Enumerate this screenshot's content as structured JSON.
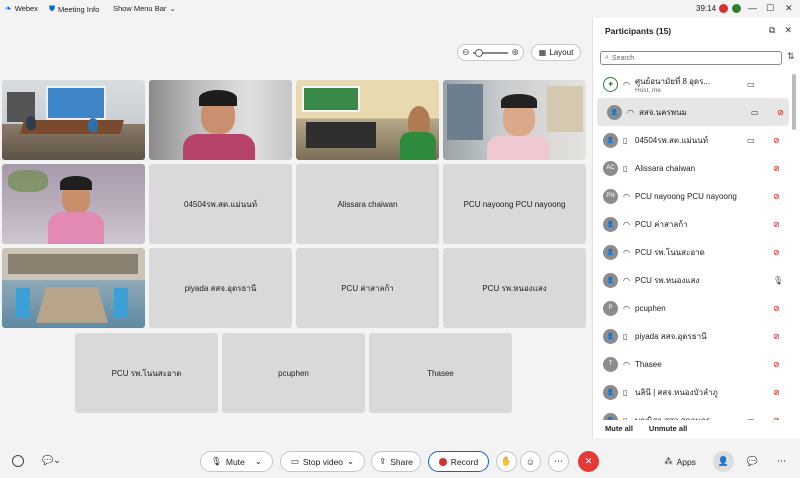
{
  "topbar": {
    "app_name": "Webex",
    "meeting_info": "Meeting Info",
    "show_menu_bar": "Show Menu Bar",
    "time": "39:14"
  },
  "stage": {
    "layout_label": "Layout",
    "tiles": [
      {
        "name": "04504รพ.สต.แม่นนท์"
      },
      {
        "name": "Alissara chaiwan"
      },
      {
        "name": "PCU nayoong PCU nayoong"
      },
      {
        "name": "piyada สสจ.อุดรธานี"
      },
      {
        "name": "PCU ค่าสาลก้า"
      },
      {
        "name": "PCU รพ.หนองแสง"
      },
      {
        "name": "PCU รพ.โนนสะอาด"
      },
      {
        "name": "pcuphen"
      },
      {
        "name": "Thasee"
      }
    ]
  },
  "bottombar": {
    "mute": "Mute",
    "stop_video": "Stop video",
    "share": "Share",
    "record": "Record",
    "apps": "Apps"
  },
  "panel": {
    "title": "Participants (15)",
    "search_placeholder": "Search",
    "mute_all": "Mute all",
    "unmute_all": "Unmute all",
    "participants": [
      {
        "name": "ศูนย์อนามัยที่ 8 อุดร...",
        "sub": "Host, me",
        "avatar": "",
        "device": "headset",
        "camera": true,
        "muted": false
      },
      {
        "name": "สสจ.นครพนม",
        "sub": "",
        "avatar": "",
        "device": "headset",
        "camera": true,
        "muted": true
      },
      {
        "name": "04504รพ.สต.แม่นนท์",
        "sub": "",
        "avatar": "",
        "device": "phone",
        "camera": true,
        "muted": true
      },
      {
        "name": "Alissara chaiwan",
        "sub": "",
        "avatar": "AC",
        "device": "phone",
        "camera": false,
        "muted": true
      },
      {
        "name": "PCU nayoong PCU nayoong",
        "sub": "",
        "avatar": "PN",
        "device": "headset",
        "camera": false,
        "muted": true
      },
      {
        "name": "PCU ค่าสาลก้า",
        "sub": "",
        "avatar": "",
        "device": "headset",
        "camera": false,
        "muted": true
      },
      {
        "name": "PCU รพ.โนนสะอาด",
        "sub": "",
        "avatar": "",
        "device": "headset",
        "camera": false,
        "muted": true
      },
      {
        "name": "PCU รพ.หนองแสง",
        "sub": "",
        "avatar": "",
        "device": "headset",
        "camera": false,
        "muted": false
      },
      {
        "name": "pcuphen",
        "sub": "",
        "avatar": "P",
        "device": "headset",
        "camera": false,
        "muted": true
      },
      {
        "name": "piyada สสจ.อุดรธานี",
        "sub": "",
        "avatar": "",
        "device": "phone",
        "camera": false,
        "muted": true
      },
      {
        "name": "Thasee",
        "sub": "",
        "avatar": "T",
        "device": "headset",
        "camera": false,
        "muted": true
      },
      {
        "name": "นลินี | สสจ.หนองบัวลำภู",
        "sub": "",
        "avatar": "",
        "device": "phone",
        "camera": false,
        "muted": true
      },
      {
        "name": "บุญนิสา สสจ.สกลนคร",
        "sub": "",
        "avatar": "",
        "device": "phone",
        "camera": true,
        "muted": true
      }
    ]
  },
  "colors": {
    "accent": "#0a64d8",
    "record_red": "#d63131",
    "end_red": "#e53935",
    "tile_gray": "#d9d9d9"
  }
}
